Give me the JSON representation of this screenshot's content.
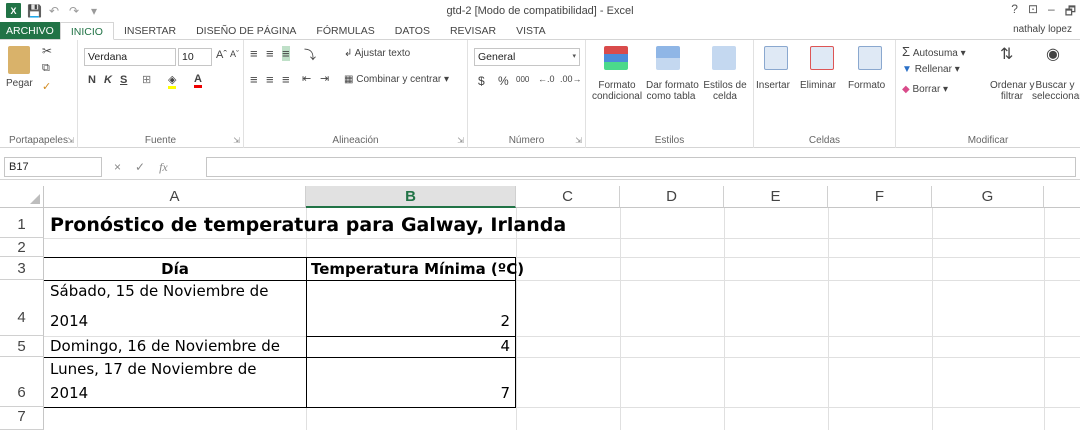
{
  "window": {
    "title": "gtd-2  [Modo de compatibilidad] - Excel",
    "logo": "X",
    "controls": [
      "?",
      "⊡",
      "–",
      "🗗"
    ]
  },
  "tabs": [
    "ARCHIVO",
    "INICIO",
    "INSERTAR",
    "DISEÑO DE PÁGINA",
    "FÓRMULAS",
    "DATOS",
    "REVISAR",
    "VISTA"
  ],
  "user": "nathaly lopez",
  "ribbon": {
    "clipboard": {
      "paste": "Pegar",
      "label": "Portapapeles"
    },
    "font": {
      "name": "Verdana",
      "size": "10",
      "label": "Fuente",
      "bold": "N",
      "italic": "K",
      "underline": "S"
    },
    "alignment": {
      "wrap": "Ajustar texto",
      "merge": "Combinar y centrar",
      "label": "Alineación"
    },
    "number": {
      "format": "General",
      "currency": "$",
      "percent": "%",
      "thousands": "000",
      "label": "Número"
    },
    "styles": {
      "conditional_1": "Formato",
      "conditional_2": "condicional",
      "table_1": "Dar formato",
      "table_2": "como tabla",
      "cell_1": "Estilos de",
      "cell_2": "celda",
      "label": "Estilos"
    },
    "cells": {
      "insert": "Insertar",
      "delete": "Eliminar",
      "format": "Formato",
      "label": "Celdas"
    },
    "editing": {
      "autosum": "Autosuma",
      "fill": "Rellenar",
      "clear": "Borrar",
      "sort_1": "Ordenar y",
      "sort_2": "filtrar",
      "find_1": "Buscar y",
      "find_2": "seleccionar",
      "label": "Modificar"
    }
  },
  "formula_bar": {
    "name_box": "B17",
    "fx": "fx",
    "cancel": "×",
    "enter": "✓",
    "value": ""
  },
  "columns": [
    "A",
    "B",
    "C",
    "D",
    "E",
    "F",
    "G"
  ],
  "rows": [
    "1",
    "2",
    "3",
    "4",
    "5",
    "6",
    "7"
  ],
  "cells": {
    "A1": "Pronóstico de temperatura para Galway, Irlanda",
    "A3": "Día",
    "B3": "Temperatura Mínima (ºC)",
    "A4_line1": "Sábado, 15 de Noviembre de",
    "A4_line2": "2014",
    "B4": "2",
    "A5": "Domingo, 16 de Noviembre de",
    "B5": "4",
    "A6_line1": "Lunes, 17 de Noviembre de",
    "A6_line2": "2014",
    "B6": "7"
  },
  "colors": {
    "accent": "#217346"
  }
}
